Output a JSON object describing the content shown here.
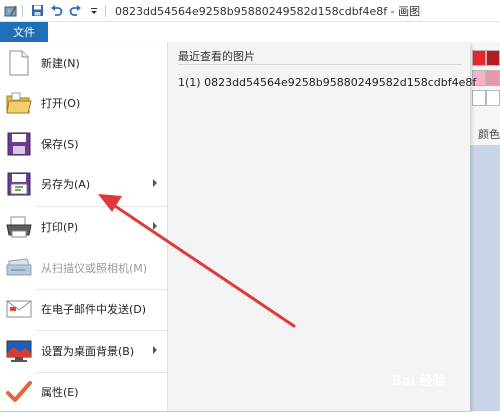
{
  "window": {
    "title": "0823dd54564e9258b95880249582d158cdbf4e8f - 画图"
  },
  "ribbon": {
    "file_tab": "文件",
    "group_label_partial": "颜色"
  },
  "file_menu": {
    "items": [
      {
        "label": "新建(N)",
        "icon": "new-document-icon",
        "submenu": false,
        "enabled": true
      },
      {
        "label": "打开(O)",
        "icon": "open-folder-icon",
        "submenu": false,
        "enabled": true
      },
      {
        "label": "保存(S)",
        "icon": "save-icon",
        "submenu": false,
        "enabled": true
      },
      {
        "label": "另存为(A)",
        "icon": "save-as-icon",
        "submenu": true,
        "enabled": true
      },
      {
        "label": "打印(P)",
        "icon": "printer-icon",
        "submenu": true,
        "enabled": true
      },
      {
        "label": "从扫描仪或照相机(M)",
        "icon": "scanner-icon",
        "submenu": false,
        "enabled": false
      },
      {
        "label": "在电子邮件中发送(D)",
        "icon": "email-icon",
        "submenu": false,
        "enabled": true
      },
      {
        "label": "设置为桌面背景(B)",
        "icon": "desktop-background-icon",
        "submenu": true,
        "enabled": true
      },
      {
        "label": "属性(E)",
        "icon": "properties-checkmark-icon",
        "submenu": false,
        "enabled": true
      }
    ]
  },
  "recent": {
    "title": "最近查看的图片",
    "items": [
      {
        "label": "1(1)  0823dd54564e9258b95880249582d158cdbf4e8f"
      }
    ]
  },
  "colors": {
    "file_tab": "#1f6fb8",
    "annotation_arrow": "#e0393b",
    "canvas": "#c9d5e6"
  },
  "watermark": "Bai 经验"
}
